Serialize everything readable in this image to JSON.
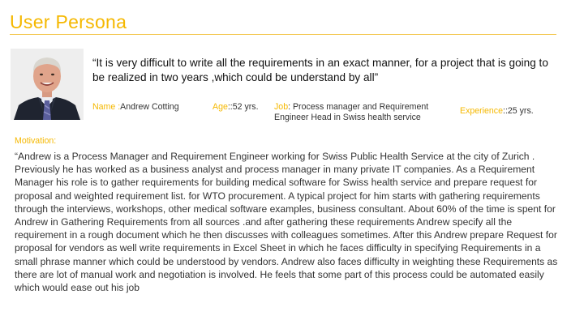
{
  "slide": {
    "title": "User Persona"
  },
  "persona": {
    "quote": "“It is very difficult to write all the requirements in an exact manner, for a project that is going to be realized in two years ,which could be understand by all”",
    "name_label": "Name :",
    "name_value": "Andrew Cotting",
    "age_label": "Age",
    "age_value": "::52 yrs.",
    "job_label": "Job",
    "job_value": ": Process manager and Requirement Engineer Head in Swiss health service",
    "experience_label": "Experience",
    "experience_value": "::25 yrs."
  },
  "motivation": {
    "label": "Motivation:",
    "text": "“Andrew is a Process Manager and Requirement  Engineer working for Swiss  Public Health Service at the city of Zurich . Previously he has worked as a business analyst and process manager in many private IT companies. As a Requirement Manager his role is to gather requirements for building medical software for  Swiss health service and prepare request for proposal and weighted requirement list. for WTO procurement. A typical project for him starts with gathering requirements through the interviews, workshops, other medical software examples, business consultant. About 60% of the time is spent for Andrew in Gathering Requirements from all sources .and after gathering these requirements Andrew specify all the requirement in a rough document which he then discusses with colleagues sometimes. After this Andrew prepare Request for proposal for vendors  as well write requirements in Excel Sheet  in which he faces difficulty in  specifying Requirements in a small phrase manner which could be understood by vendors. Andrew also faces difficulty in weighting these Requirements as there are lot of manual work and negotiation is involved. He feels that some part of this process could be automated easily which would ease out his job"
  }
}
